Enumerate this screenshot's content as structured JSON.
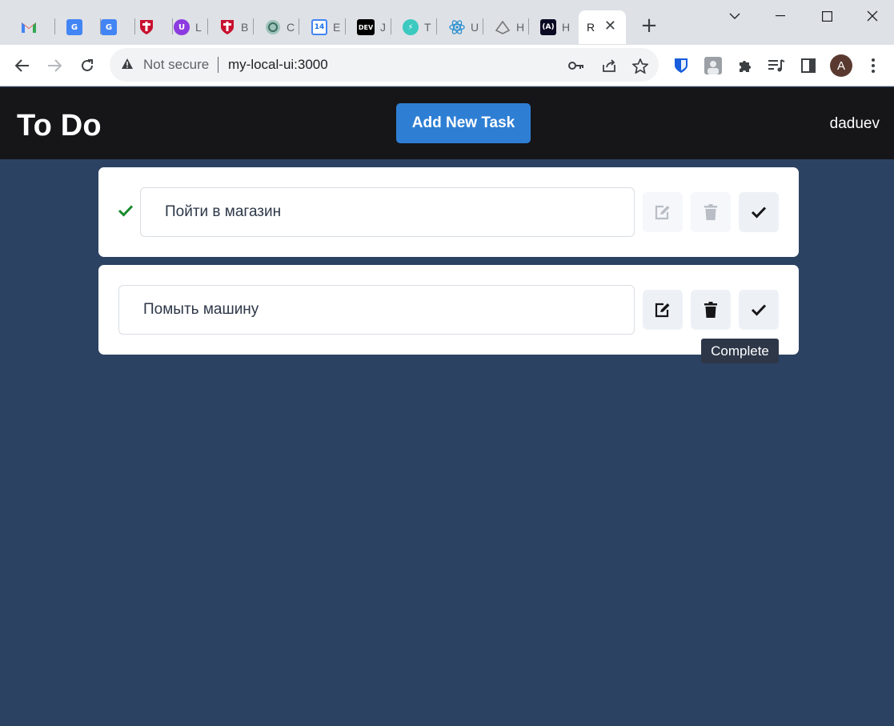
{
  "browser": {
    "tabs": [
      {
        "icon": "gmail-icon",
        "label": ""
      },
      {
        "icon": "google-translate-icon",
        "label": ""
      },
      {
        "icon": "google-translate-icon",
        "label": ""
      },
      {
        "icon": "cambridge-shield-icon",
        "label": ""
      },
      {
        "icon": "purple-u-icon",
        "label": "L"
      },
      {
        "icon": "cambridge-shield-icon",
        "label": "B"
      },
      {
        "icon": "chatgpt-icon",
        "label": "C"
      },
      {
        "icon": "calendar-icon",
        "label": "E",
        "badge": "14"
      },
      {
        "icon": "dev-icon",
        "label": "J",
        "badge": "DEV"
      },
      {
        "icon": "bolt-icon",
        "label": "T"
      },
      {
        "icon": "react-icon",
        "label": "U"
      },
      {
        "icon": "pen-tool-icon",
        "label": "H"
      },
      {
        "icon": "fcc-icon",
        "label": "H",
        "badge": "(A)"
      },
      {
        "icon": "blank-icon",
        "label": "R"
      }
    ],
    "address": {
      "security_label": "Not secure",
      "url": "my-local-ui:3000"
    },
    "profile_initial": "A"
  },
  "app": {
    "title": "To Do",
    "add_button": "Add New Task",
    "username": "daduev",
    "tasks": [
      {
        "text": "Пойти в магазин",
        "completed": true
      },
      {
        "text": "Помыть машину",
        "completed": false
      }
    ],
    "tooltip": "Complete"
  },
  "colors": {
    "page_bg": "#2c4263",
    "header_bg": "#161518",
    "accent": "#2e7fd4",
    "check_green": "#178a2c"
  }
}
